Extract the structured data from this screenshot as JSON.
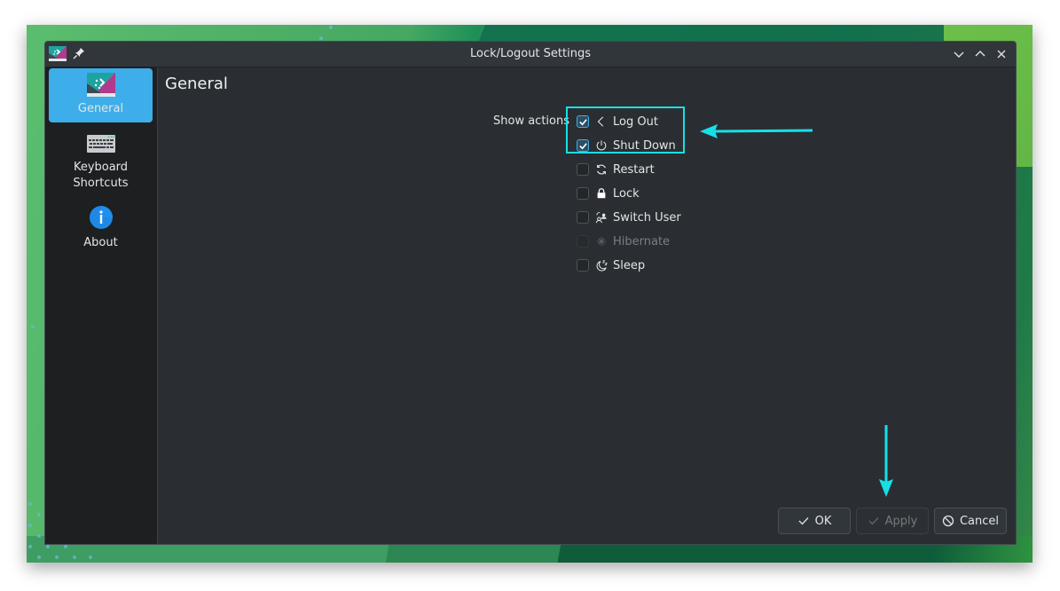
{
  "window": {
    "title": "Lock/Logout Settings",
    "controls": [
      "minimize",
      "maximize",
      "close"
    ]
  },
  "sidebar": {
    "items": [
      {
        "label": "General",
        "icon": "desktop-icon",
        "active": true
      },
      {
        "label": "Keyboard Shortcuts",
        "label_line1": "Keyboard",
        "label_line2": "Shortcuts",
        "icon": "keyboard-icon",
        "active": false
      },
      {
        "label": "About",
        "icon": "info-icon",
        "active": false
      }
    ]
  },
  "main": {
    "title": "General",
    "show_actions_label": "Show actions",
    "actions": [
      {
        "label": "Log Out",
        "icon": "logout-icon",
        "checked": true,
        "enabled": true
      },
      {
        "label": "Shut Down",
        "icon": "power-icon",
        "checked": true,
        "enabled": true
      },
      {
        "label": "Restart",
        "icon": "restart-icon",
        "checked": false,
        "enabled": true
      },
      {
        "label": "Lock",
        "icon": "lock-icon",
        "checked": false,
        "enabled": true
      },
      {
        "label": "Switch User",
        "icon": "switch-user-icon",
        "checked": false,
        "enabled": true
      },
      {
        "label": "Hibernate",
        "icon": "hibernate-icon",
        "checked": false,
        "enabled": false
      },
      {
        "label": "Sleep",
        "icon": "sleep-icon",
        "checked": false,
        "enabled": true
      }
    ]
  },
  "buttons": {
    "ok": {
      "label": "OK",
      "enabled": true
    },
    "apply": {
      "label": "Apply",
      "enabled": false
    },
    "cancel": {
      "label": "Cancel",
      "enabled": true
    }
  },
  "annotations": {
    "highlight_color": "#16e0e6",
    "arrow_color": "#16e0e6"
  },
  "colors": {
    "accent": "#3daee9",
    "window_bg": "#2a2e32",
    "sidebar_bg": "#1d1f21"
  }
}
